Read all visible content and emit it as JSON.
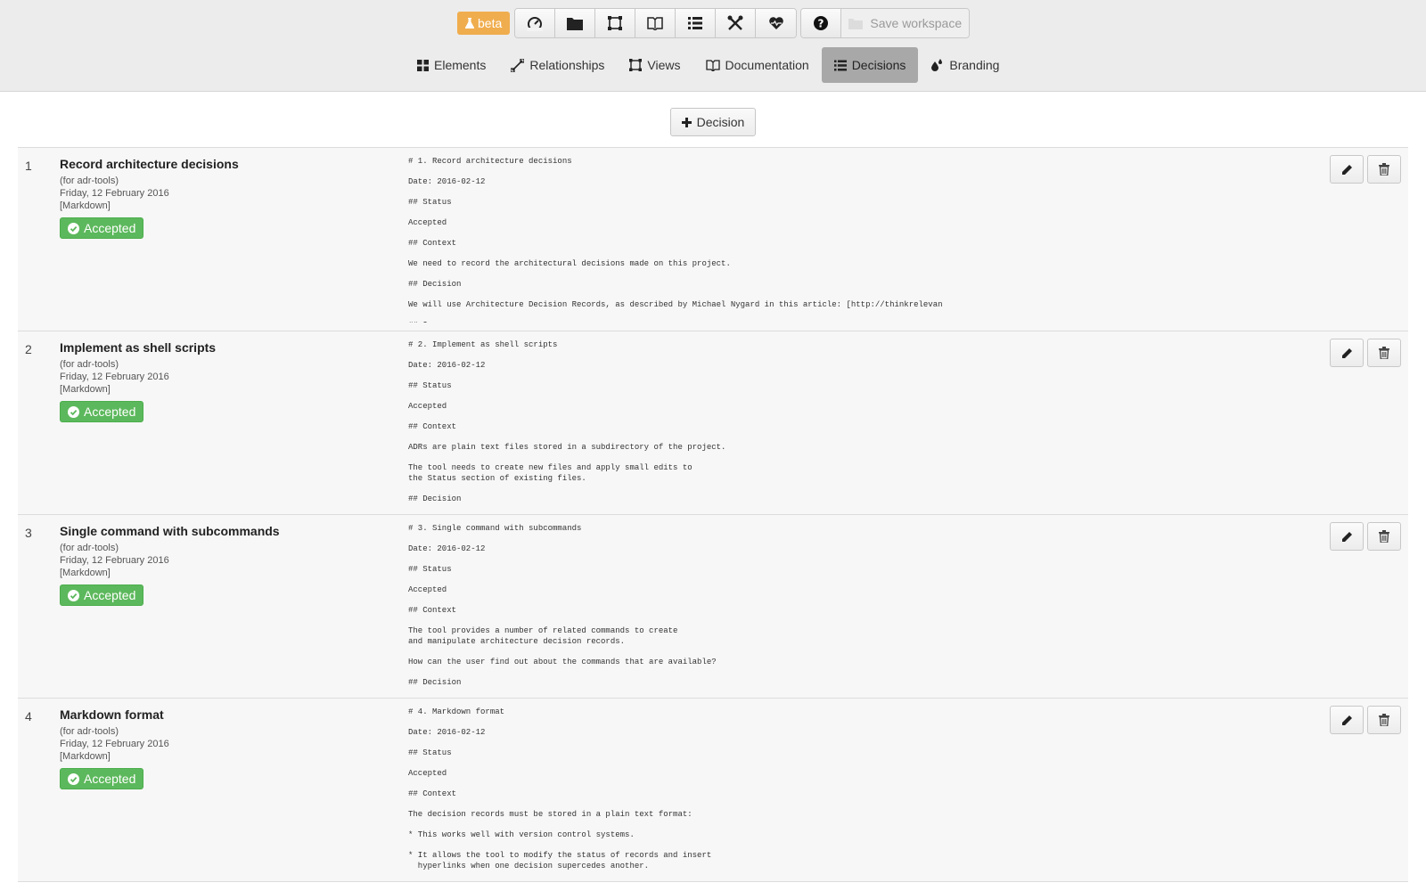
{
  "toolbar": {
    "beta_label": "beta",
    "icons": [
      "dashboard-icon",
      "folder-icon",
      "views-icon",
      "documentation-icon",
      "decisions-icon",
      "tools-icon",
      "health-icon"
    ],
    "save_label": "Save workspace"
  },
  "tabs": [
    {
      "label": "Elements",
      "icon": "grid-icon"
    },
    {
      "label": "Relationships",
      "icon": "relationship-icon"
    },
    {
      "label": "Views",
      "icon": "views-icon"
    },
    {
      "label": "Documentation",
      "icon": "book-icon"
    },
    {
      "label": "Decisions",
      "icon": "list-icon",
      "active": true
    },
    {
      "label": "Branding",
      "icon": "drops-icon"
    }
  ],
  "add_decision_label": "Decision",
  "colors": {
    "accepted": "#5cb85c",
    "beta": "#f0ad4e",
    "active_tab": "#a8a8a8"
  },
  "decisions": [
    {
      "number": "1",
      "title": "Record architecture decisions",
      "scope": "(for adr-tools)",
      "date": "Friday, 12 February 2016",
      "format": "[Markdown]",
      "status": "Accepted",
      "content": "# 1. Record architecture decisions\n\nDate: 2016-02-12\n\n## Status\n\nAccepted\n\n## Context\n\nWe need to record the architectural decisions made on this project.\n\n## Decision\n\nWe will use Architecture Decision Records, as described by Michael Nygard in this article: [http://thinkrelevan\n\n## Consequences"
    },
    {
      "number": "2",
      "title": "Implement as shell scripts",
      "scope": "(for adr-tools)",
      "date": "Friday, 12 February 2016",
      "format": "[Markdown]",
      "status": "Accepted",
      "content": "# 2. Implement as shell scripts\n\nDate: 2016-02-12\n\n## Status\n\nAccepted\n\n## Context\n\nADRs are plain text files stored in a subdirectory of the project.\n\nThe tool needs to create new files and apply small edits to\nthe Status section of existing files.\n\n## Decision"
    },
    {
      "number": "3",
      "title": "Single command with subcommands",
      "scope": "(for adr-tools)",
      "date": "Friday, 12 February 2016",
      "format": "[Markdown]",
      "status": "Accepted",
      "content": "# 3. Single command with subcommands\n\nDate: 2016-02-12\n\n## Status\n\nAccepted\n\n## Context\n\nThe tool provides a number of related commands to create\nand manipulate architecture decision records.\n\nHow can the user find out about the commands that are available?\n\n## Decision"
    },
    {
      "number": "4",
      "title": "Markdown format",
      "scope": "(for adr-tools)",
      "date": "Friday, 12 February 2016",
      "format": "[Markdown]",
      "status": "Accepted",
      "content": "# 4. Markdown format\n\nDate: 2016-02-12\n\n## Status\n\nAccepted\n\n## Context\n\nThe decision records must be stored in a plain text format:\n\n* This works well with version control systems.\n\n* It allows the tool to modify the status of records and insert\n  hyperlinks when one decision supercedes another."
    }
  ]
}
